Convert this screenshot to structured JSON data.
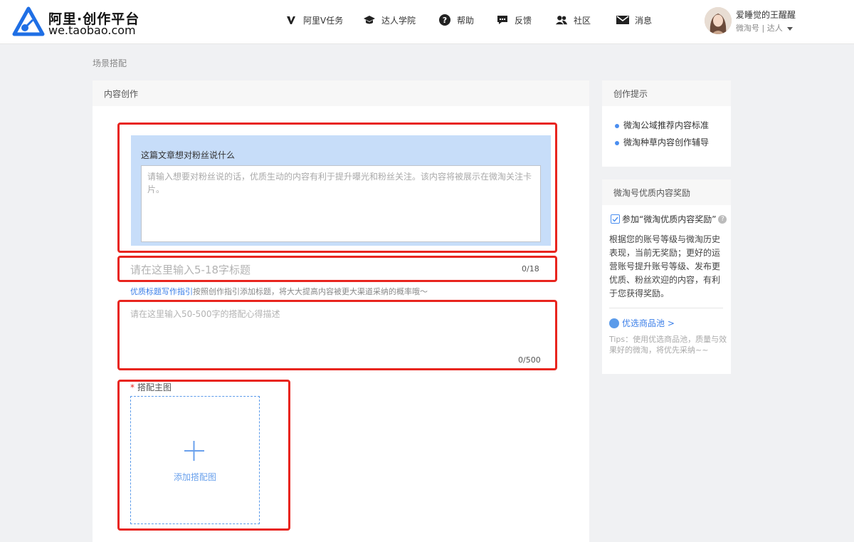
{
  "header": {
    "logo_title": "阿里·创作平台",
    "logo_sub": "we.taobao.com",
    "nav": [
      {
        "label": "阿里V任务",
        "icon": "v-icon"
      },
      {
        "label": "达人学院",
        "icon": "graduation-cap-icon"
      },
      {
        "label": "帮助",
        "icon": "question-circle-icon"
      },
      {
        "label": "反馈",
        "icon": "chat-bubble-icon"
      },
      {
        "label": "社区",
        "icon": "users-icon"
      },
      {
        "label": "消息",
        "icon": "envelope-icon"
      }
    ],
    "user": {
      "name": "爱睡觉的王醒醒",
      "role": "微淘号 | 达人"
    }
  },
  "breadcrumb": "场景搭配",
  "main": {
    "panel_title": "内容创作",
    "fan_message": {
      "title": "这篇文章想对粉丝说什么",
      "placeholder": "请输入想要对粉丝说的话，优质生动的内容有利于提升曝光和粉丝关注。该内容将被展示在微淘关注卡片。"
    },
    "title_field": {
      "placeholder": "请在这里输入5-18字标题",
      "count": "0/18"
    },
    "guide": {
      "link": "优质标题写作指引",
      "text": "按照创作指引添加标题，将大大提高内容被更大渠道采纳的概率哦～"
    },
    "desc_field": {
      "placeholder": "请在这里输入50-500字的搭配心得描述",
      "count": "0/500"
    },
    "main_image": {
      "required_mark": "*",
      "label": "搭配主图",
      "upload_text": "添加搭配图"
    }
  },
  "sidebar": {
    "tips": {
      "title": "创作提示",
      "links": [
        "微淘公域推荐内容标准",
        "微淘种草内容创作辅导"
      ]
    },
    "reward": {
      "title": "微淘号优质内容奖励",
      "checkbox_label": "参加“微淘优质内容奖励”",
      "checked": true,
      "text": "根据您的账号等级与微淘历史表现，当前无奖励；更好的运营账号提升账号等级、发布更优质、粉丝欢迎的内容，有利于您获得奖励。",
      "pool_link": "优选商品池 >",
      "pool_tip": "Tips：使用优选商品池，质量与效果好的微淘，将优先采纳~~"
    }
  },
  "colors": {
    "accent": "#3a7ee8",
    "highlight": "#e8251e",
    "tip_bg": "#c7ddf9"
  }
}
